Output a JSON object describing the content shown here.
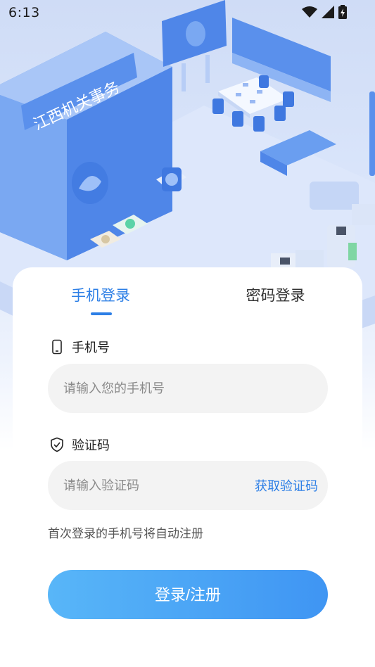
{
  "status_bar": {
    "time": "6:13"
  },
  "hero": {
    "building_sign": "江西机关事务"
  },
  "tabs": {
    "phone_login": "手机登录",
    "password_login": "密码登录",
    "active": "phone_login"
  },
  "form": {
    "phone": {
      "label": "手机号",
      "placeholder": "请输入您的手机号",
      "value": ""
    },
    "code": {
      "label": "验证码",
      "placeholder": "请输入验证码",
      "value": "",
      "get_code_label": "获取验证码"
    },
    "hint": "首次登录的手机号将自动注册",
    "submit_label": "登录/注册"
  },
  "colors": {
    "accent": "#2d7fe6",
    "button_start": "#58b6f8",
    "button_end": "#3f95f3",
    "input_bg": "#f3f3f3"
  },
  "icons": {
    "phone_field": "mobile-phone-icon",
    "code_field": "shield-check-icon",
    "wifi": "wifi-icon",
    "signal": "signal-icon",
    "battery": "battery-charging-icon"
  }
}
